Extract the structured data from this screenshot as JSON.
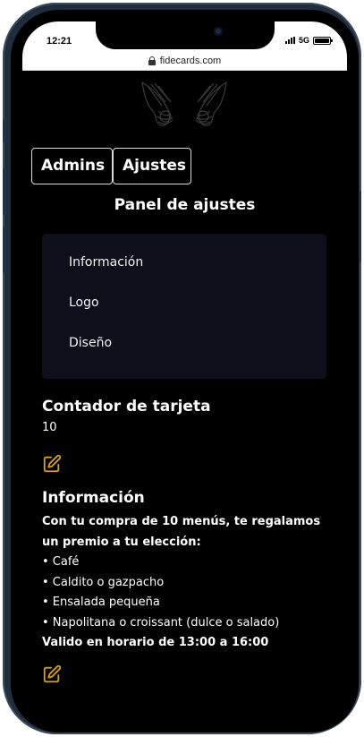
{
  "status": {
    "time": "12:21",
    "network": "5G"
  },
  "browser": {
    "url": "fidecards.com"
  },
  "tabs": [
    {
      "label": "Admins"
    },
    {
      "label": "Ajustes"
    }
  ],
  "panel": {
    "title": "Panel de ajustes",
    "items": [
      {
        "label": "Información"
      },
      {
        "label": "Logo"
      },
      {
        "label": "Diseño"
      }
    ]
  },
  "counter": {
    "heading": "Contador de tarjeta",
    "value": "10"
  },
  "info": {
    "heading": "Información",
    "intro": "Con tu compra de 10 menús, te regalamos un premio a tu elección:",
    "items": [
      "• Café",
      "• Caldito o gazpacho",
      "• Ensalada pequeña",
      "• Napolitana o croissant (dulce o salado)"
    ],
    "footer": "Valido en horario de 13:00 a 16:00"
  },
  "colors": {
    "accent": "#d4a017",
    "background": "#000000",
    "card": "#0d0f1a"
  }
}
